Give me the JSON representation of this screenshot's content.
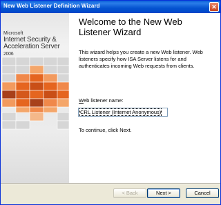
{
  "window": {
    "title": "New Web Listener Definition Wizard"
  },
  "sidebar": {
    "logo": {
      "company": "Microsoft",
      "product_line1": "Internet Security &",
      "product_line2": "Acceleration Server",
      "year": "2006"
    }
  },
  "main": {
    "heading": "Welcome to the New Web Listener Wizard",
    "description": "This wizard helps you create a new Web listener. Web listeners specify how ISA Server listens for and authenticates incoming Web requests from clients.",
    "name_label_accesskey": "W",
    "name_label_rest": "eb listener name:",
    "name_value": "CRL Listener (Internet Anonymous)",
    "continue_text": "To continue, click Next."
  },
  "footer": {
    "back_label": "< Back",
    "next_label": "Next >",
    "cancel_label": "Cancel"
  },
  "colors": {
    "title_bar": "#0553d0",
    "orange": "#e5651f",
    "dark_orange": "#a8401a",
    "light_orange": "#f4a66a"
  }
}
